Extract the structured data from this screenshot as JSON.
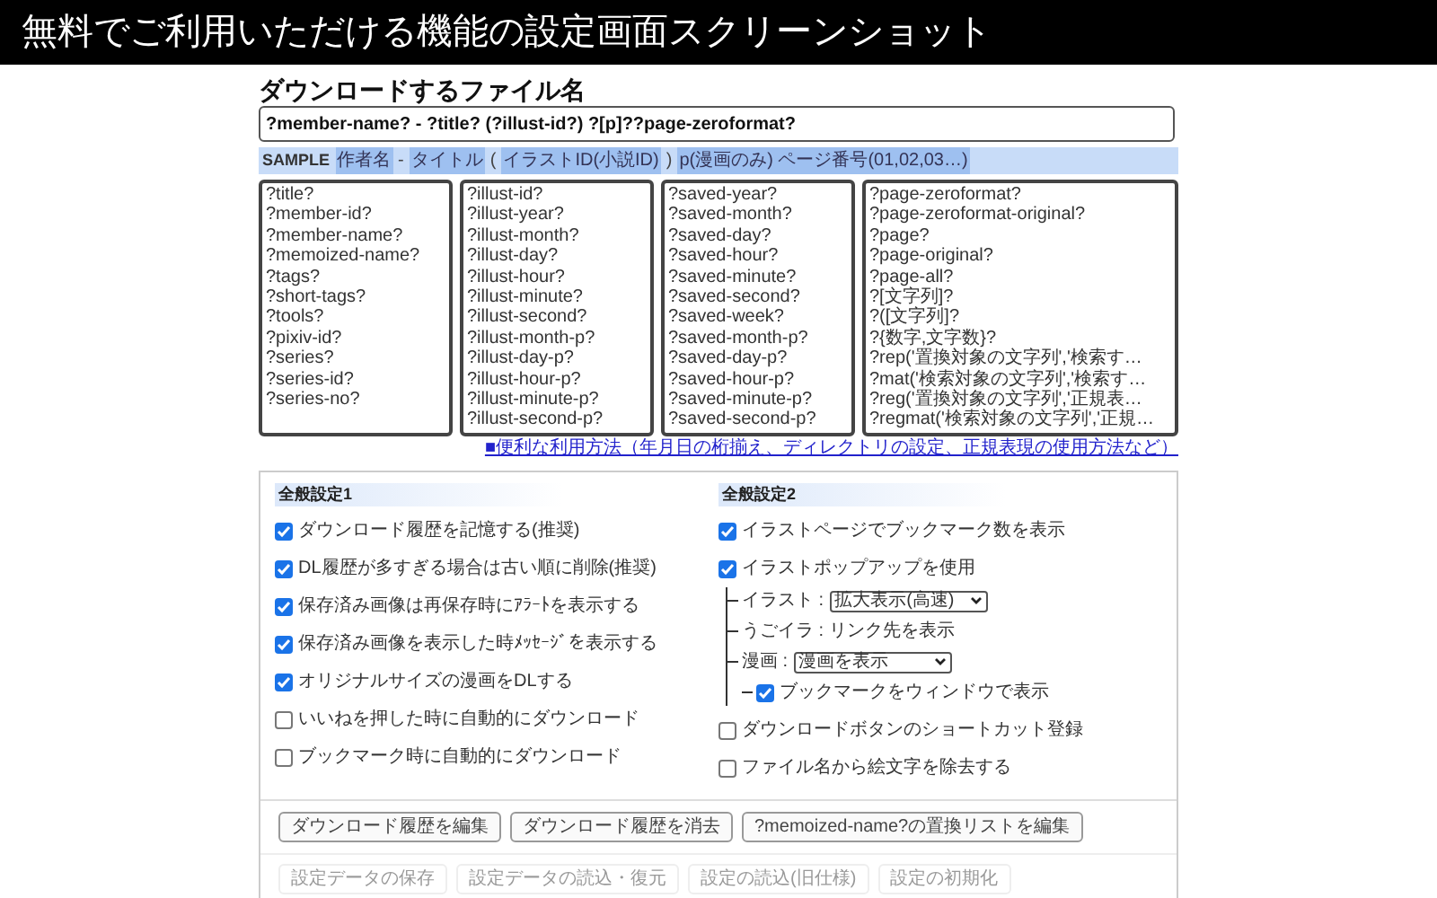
{
  "banner": {
    "title": "無料でご利用いただける機能の設定画面スクリーンショット"
  },
  "filename": {
    "heading": "ダウンロードするファイル名",
    "value": "?member-name? - ?title? (?illust-id?) ?[p]??page-zeroformat?"
  },
  "sample": {
    "label": "SAMPLE",
    "segments": [
      {
        "text": "作者名",
        "highlight": true
      },
      {
        "text": "-",
        "highlight": false
      },
      {
        "text": "タイトル",
        "highlight": true
      },
      {
        "text": "(",
        "highlight": false
      },
      {
        "text": "イラストID(小説ID)",
        "highlight": true
      },
      {
        "text": ")",
        "highlight": false
      },
      {
        "text": "p(漫画のみ) ページ番号(01,02,03…)",
        "highlight": true
      }
    ]
  },
  "tag_lists": [
    [
      "?title?",
      "?member-id?",
      "?member-name?",
      "?memoized-name?",
      "?tags?",
      "?short-tags?",
      "?tools?",
      "?pixiv-id?",
      "?series?",
      "?series-id?",
      "?series-no?"
    ],
    [
      "?illust-id?",
      "?illust-year?",
      "?illust-month?",
      "?illust-day?",
      "?illust-hour?",
      "?illust-minute?",
      "?illust-second?",
      "?illust-month-p?",
      "?illust-day-p?",
      "?illust-hour-p?",
      "?illust-minute-p?",
      "?illust-second-p?"
    ],
    [
      "?saved-year?",
      "?saved-month?",
      "?saved-day?",
      "?saved-hour?",
      "?saved-minute?",
      "?saved-second?",
      "?saved-week?",
      "?saved-month-p?",
      "?saved-day-p?",
      "?saved-hour-p?",
      "?saved-minute-p?",
      "?saved-second-p?"
    ],
    [
      "?page-zeroformat?",
      "?page-zeroformat-original?",
      "?page?",
      "?page-original?",
      "?page-all?",
      "?[文字列]?",
      "?([文字列]?",
      "?{数字,文字数}?",
      "?rep('置換対象の文字列','検索す…",
      "?mat('検索対象の文字列','検索す…",
      "?reg('置換対象の文字列','正規表…",
      "?regmat('検索対象の文字列','正規…"
    ]
  ],
  "help_link": "■便利な利用方法（年月日の桁揃え、ディレクトリの設定、正規表現の使用方法など）",
  "settings": [
    {
      "heading": "全般設定1",
      "items": [
        {
          "kind": "checkbox",
          "label": "ダウンロード履歴を記憶する(推奨)",
          "checked": true
        },
        {
          "kind": "checkbox",
          "label": "DL履歴が多すぎる場合は古い順に削除(推奨)",
          "checked": true
        },
        {
          "kind": "checkbox",
          "label": "保存済み画像は再保存時にｱﾗｰﾄを表示する",
          "checked": true
        },
        {
          "kind": "checkbox",
          "label": "保存済み画像を表示した時ﾒｯｾｰｼﾞを表示する",
          "checked": true
        },
        {
          "kind": "checkbox",
          "label": "オリジナルサイズの漫画をDLする",
          "checked": true
        },
        {
          "kind": "checkbox",
          "label": "いいねを押した時に自動的にダウンロード",
          "checked": false
        },
        {
          "kind": "checkbox",
          "label": "ブックマーク時に自動的にダウンロード",
          "checked": false
        }
      ]
    },
    {
      "heading": "全般設定2",
      "items": [
        {
          "kind": "checkbox",
          "label": "イラストページでブックマーク数を表示",
          "checked": true
        },
        {
          "kind": "checkbox",
          "label": "イラストポップアップを使用",
          "checked": true,
          "children": [
            {
              "kind": "select",
              "label": "イラスト :",
              "value": "拡大表示(高速)"
            },
            {
              "kind": "text",
              "label": "うごイラ : リンク先を表示"
            },
            {
              "kind": "select",
              "label": "漫画 :",
              "value": "漫画を表示"
            },
            {
              "kind": "checkbox",
              "label": "ブックマークをウィンドウで表示",
              "checked": true
            }
          ]
        },
        {
          "kind": "checkbox",
          "label": "ダウンロードボタンのショートカット登録",
          "checked": false
        },
        {
          "kind": "checkbox",
          "label": "ファイル名から絵文字を除去する",
          "checked": false
        }
      ]
    }
  ],
  "buttons": [
    {
      "label": "ダウンロード履歴を編集",
      "disabled": false
    },
    {
      "label": "ダウンロード履歴を消去",
      "disabled": false
    },
    {
      "label": "?memoized-name?の置換リストを編集",
      "disabled": false
    }
  ],
  "buttons_2": [
    {
      "label": "設定データの保存",
      "disabled": true
    },
    {
      "label": "設定データの読込・復元",
      "disabled": true
    },
    {
      "label": "設定の読込(旧仕様)",
      "disabled": true
    },
    {
      "label": "設定の初期化",
      "disabled": true
    }
  ]
}
